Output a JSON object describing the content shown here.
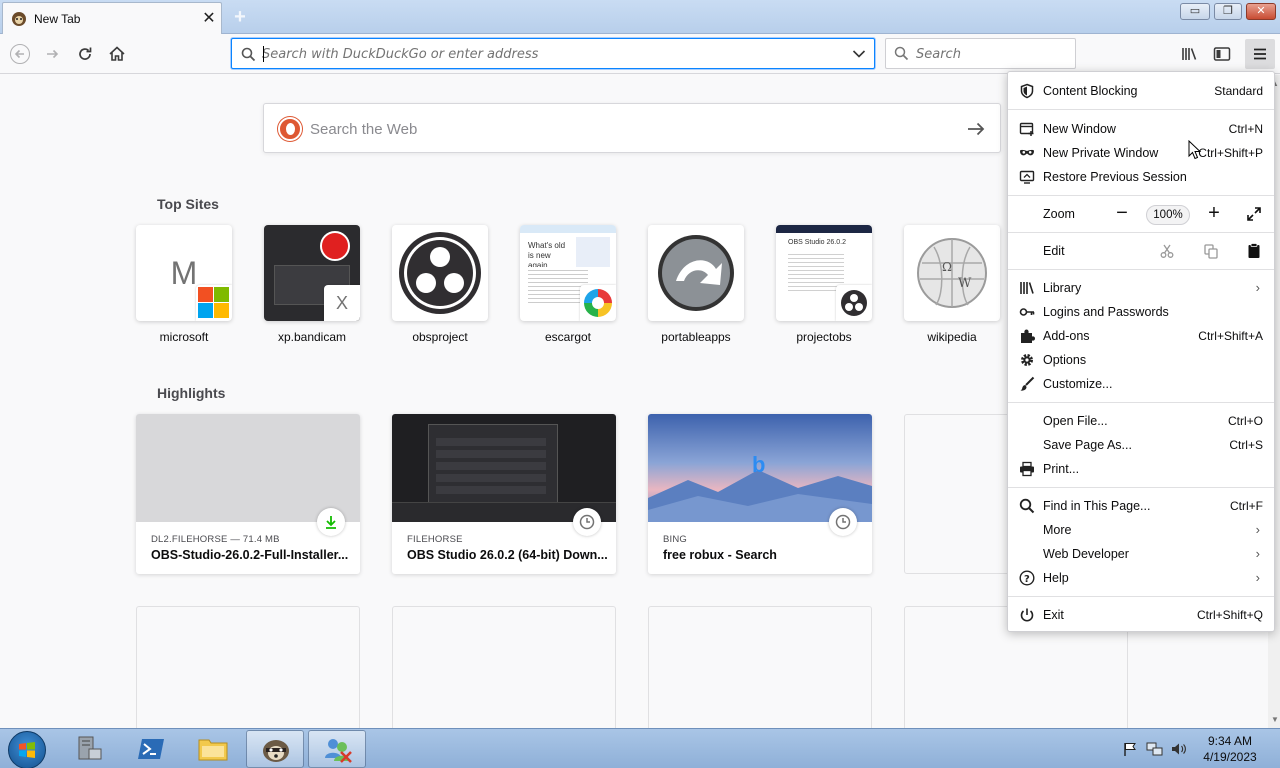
{
  "window": {
    "tab_title": "New Tab",
    "minimize": "▭",
    "restore": "❐",
    "close": "✕"
  },
  "toolbar": {
    "url_placeholder": "Search with DuckDuckGo or enter address",
    "search_placeholder": "Search"
  },
  "content": {
    "websearch_placeholder": "Search the Web",
    "top_sites_title": "Top Sites",
    "highlights_title": "Highlights",
    "top_sites": [
      {
        "label": "microsoft",
        "letter": "M"
      },
      {
        "label": "xp.bandicam",
        "letter": "X"
      },
      {
        "label": "obsproject"
      },
      {
        "label": "escargot",
        "thumb_heading": "What's old is new again"
      },
      {
        "label": "portableapps"
      },
      {
        "label": "projectobs",
        "thumb_heading": "OBS Studio 26.0.2"
      },
      {
        "label": "wikipedia"
      }
    ],
    "highlights": [
      {
        "source": "DL2.FILEHORSE — 71.4 MB",
        "title": "OBS-Studio-26.0.2-Full-Installer...",
        "icon": "download-icon"
      },
      {
        "source": "FILEHORSE",
        "title": "OBS Studio 26.0.2 (64-bit) Down...",
        "icon": "clock-icon"
      },
      {
        "source": "BING",
        "title": "free robux - Search",
        "icon": "clock-icon"
      }
    ]
  },
  "menu": {
    "content_blocking": "Content Blocking",
    "content_blocking_value": "Standard",
    "new_window": "New Window",
    "new_window_key": "Ctrl+N",
    "new_private_window": "New Private Window",
    "new_private_window_key": "Ctrl+Shift+P",
    "restore_session": "Restore Previous Session",
    "zoom": "Zoom",
    "zoom_value": "100%",
    "edit": "Edit",
    "library": "Library",
    "logins": "Logins and Passwords",
    "addons": "Add-ons",
    "addons_key": "Ctrl+Shift+A",
    "options": "Options",
    "customize": "Customize...",
    "open_file": "Open File...",
    "open_file_key": "Ctrl+O",
    "save_page": "Save Page As...",
    "save_page_key": "Ctrl+S",
    "print": "Print...",
    "find": "Find in This Page...",
    "find_key": "Ctrl+F",
    "more": "More",
    "web_developer": "Web Developer",
    "help": "Help",
    "exit": "Exit",
    "exit_key": "Ctrl+Shift+Q"
  },
  "taskbar": {
    "time": "9:34 AM",
    "date": "4/19/2023"
  },
  "colors": {
    "accent": "#0a84ff",
    "ddg": "#de5833",
    "titlebar": "#c9dcf3"
  }
}
